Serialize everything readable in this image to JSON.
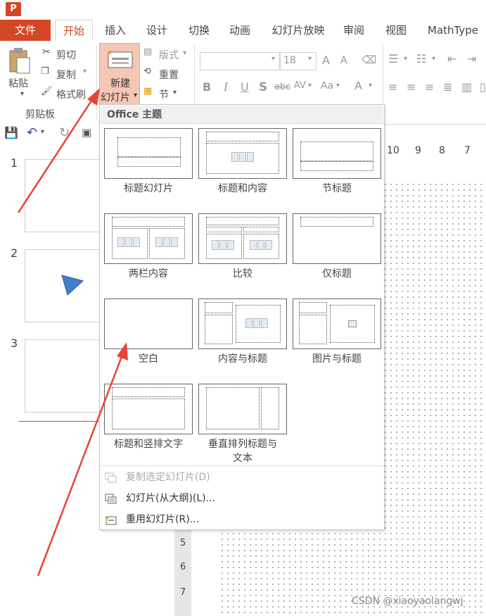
{
  "app": {
    "icon_letter": "P"
  },
  "tabs": [
    "文件",
    "开始",
    "插入",
    "设计",
    "切换",
    "动画",
    "幻灯片放映",
    "审阅",
    "视图",
    "MathType"
  ],
  "ribbon": {
    "paste": "粘贴",
    "cut": "剪切",
    "copy": "复制",
    "format_painter": "格式刷",
    "clipboard_group": "剪贴板",
    "new_slide_line1": "新建",
    "new_slide_line2": "幻灯片",
    "layout": "版式",
    "reset": "重置",
    "section": "节",
    "font_size": "18",
    "bold": "B",
    "italic": "I",
    "underline": "U",
    "shadow": "S",
    "strike": "abc",
    "spacing": "AV",
    "case": "Aa",
    "font_color": "A",
    "grow": "A",
    "shrink": "A"
  },
  "slides": [
    "1",
    "2",
    "3"
  ],
  "ruler": [
    "10",
    "9",
    "8",
    "7"
  ],
  "ruler_v": [
    "5",
    "6",
    "7"
  ],
  "dropdown": {
    "header": "Office 主题",
    "layouts": [
      {
        "name": "标题幻灯片"
      },
      {
        "name": "标题和内容"
      },
      {
        "name": "节标题"
      },
      {
        "name": "两栏内容"
      },
      {
        "name": "比较"
      },
      {
        "name": "仅标题"
      },
      {
        "name": "空白"
      },
      {
        "name": "内容与标题"
      },
      {
        "name": "图片与标题"
      },
      {
        "name": "标题和竖排文字"
      },
      {
        "name_line1": "垂直排列标题与",
        "name_line2": "文本"
      }
    ],
    "menu": [
      {
        "label": "复制选定幻灯片(D)",
        "enabled": false
      },
      {
        "label": "幻灯片(从大纲)(L)...",
        "enabled": true
      },
      {
        "label": "重用幻灯片(R)...",
        "enabled": true
      }
    ]
  },
  "watermark": "CSDN @xiaoyaolangwj",
  "colors": {
    "accent": "#d24726",
    "arrow": "#e8433a",
    "highlight": "#f5c7b4"
  }
}
